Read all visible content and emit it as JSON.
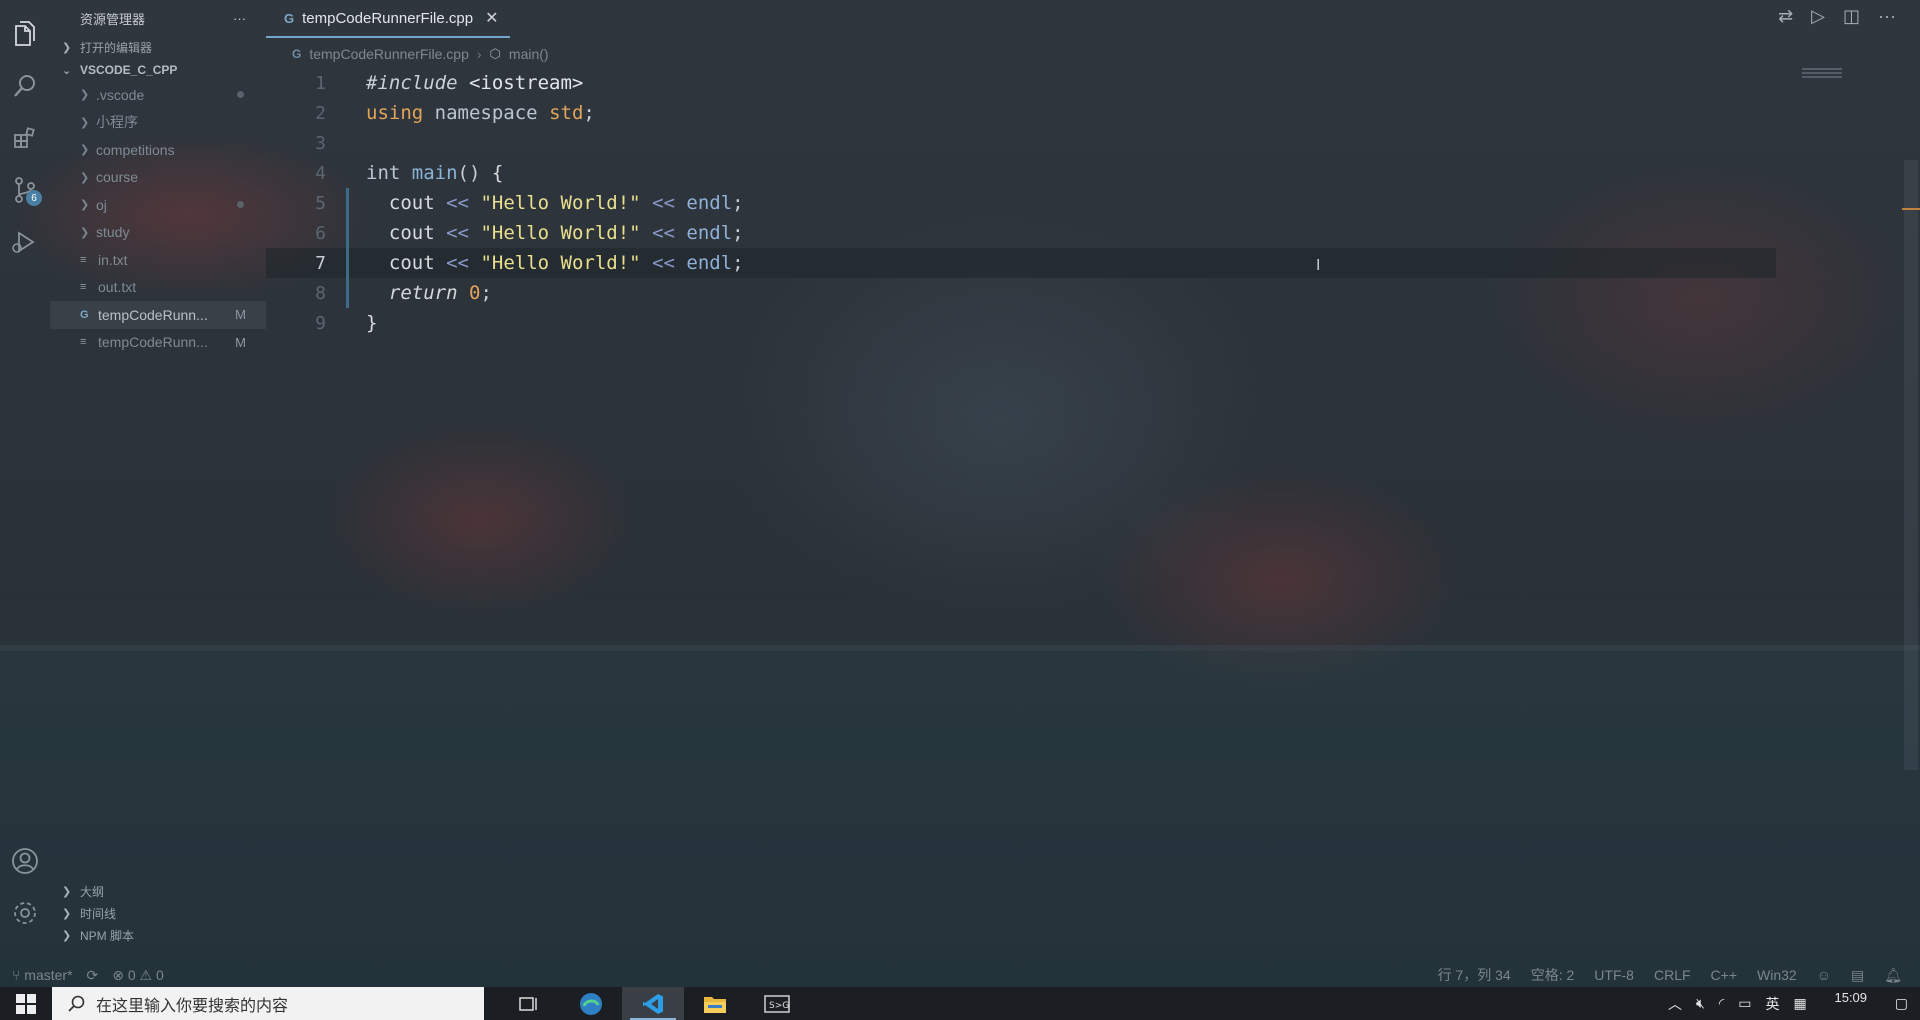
{
  "activity_bar": {
    "items": [
      {
        "name": "explorer"
      },
      {
        "name": "search"
      },
      {
        "name": "extensions"
      },
      {
        "name": "source-control",
        "badge": "6"
      },
      {
        "name": "run-debug"
      }
    ]
  },
  "sidebar": {
    "title": "资源管理器",
    "more": "···",
    "open_editors": "打开的编辑器",
    "workspace": "VSCODE_C_CPP",
    "tree": [
      {
        "label": ".vscode",
        "type": "folder",
        "dot": true
      },
      {
        "label": "小程序",
        "type": "folder"
      },
      {
        "label": "competitions",
        "type": "folder"
      },
      {
        "label": "course",
        "type": "folder"
      },
      {
        "label": "oj",
        "type": "folder",
        "dot": true
      },
      {
        "label": "study",
        "type": "folder"
      },
      {
        "label": "in.txt",
        "type": "file"
      },
      {
        "label": "out.txt",
        "type": "file"
      },
      {
        "label": "tempCodeRunn...",
        "type": "cpp",
        "status": "M"
      },
      {
        "label": "tempCodeRunn...",
        "type": "file",
        "status": "M"
      }
    ],
    "outline": "大纲",
    "timeline": "时间线",
    "npm": "NPM 脚本"
  },
  "editor": {
    "tab": {
      "label": "tempCodeRunnerFile.cpp",
      "close": "✕"
    },
    "breadcrumb": {
      "file": "tempCodeRunnerFile.cpp",
      "symbol": "main()"
    },
    "line_numbers": [
      "1",
      "2",
      "3",
      "4",
      "5",
      "6",
      "7",
      "8",
      "9"
    ],
    "current_line": 7
  },
  "statusbar": {
    "branch": "master*",
    "problems": "⊗ 0 ⚠ 0",
    "position": "行 7，列 34",
    "spaces": "空格: 2",
    "encoding": "UTF-8",
    "eol": "CRLF",
    "language": "C++",
    "platform": "Win32"
  },
  "taskbar": {
    "search_placeholder": "在这里输入你要搜索的内容",
    "time": "15:09",
    "ime": "英"
  }
}
